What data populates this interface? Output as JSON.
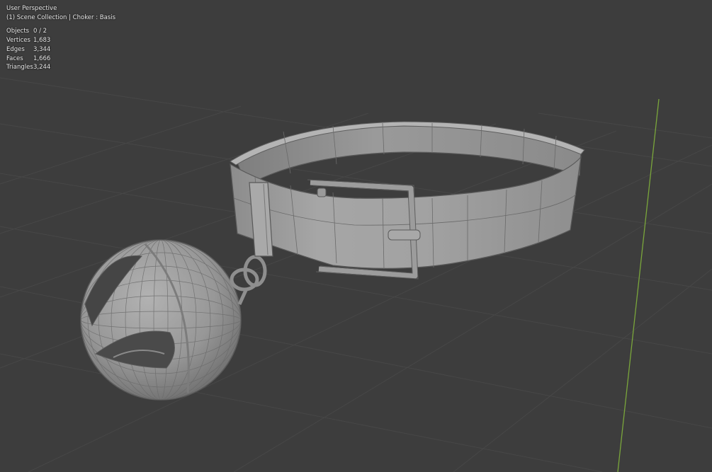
{
  "viewport": {
    "view_name": "User Perspective",
    "context": "(1) Scene Collection | Choker : Basis",
    "stats": [
      {
        "label": "Objects",
        "value": "0 / 2"
      },
      {
        "label": "Vertices",
        "value": "1,683"
      },
      {
        "label": "Edges",
        "value": "3,344"
      },
      {
        "label": "Faces",
        "value": "1,666"
      },
      {
        "label": "Triangles",
        "value": "3,244"
      }
    ]
  },
  "colors": {
    "background": "#3d3d3d",
    "grid": "#474747",
    "y_axis": "#7aa63b",
    "mesh": "#9a9a9a",
    "wire": "#5c5c5c"
  },
  "scene": {
    "objects": [
      "choker-collar",
      "bell-pendant"
    ]
  }
}
